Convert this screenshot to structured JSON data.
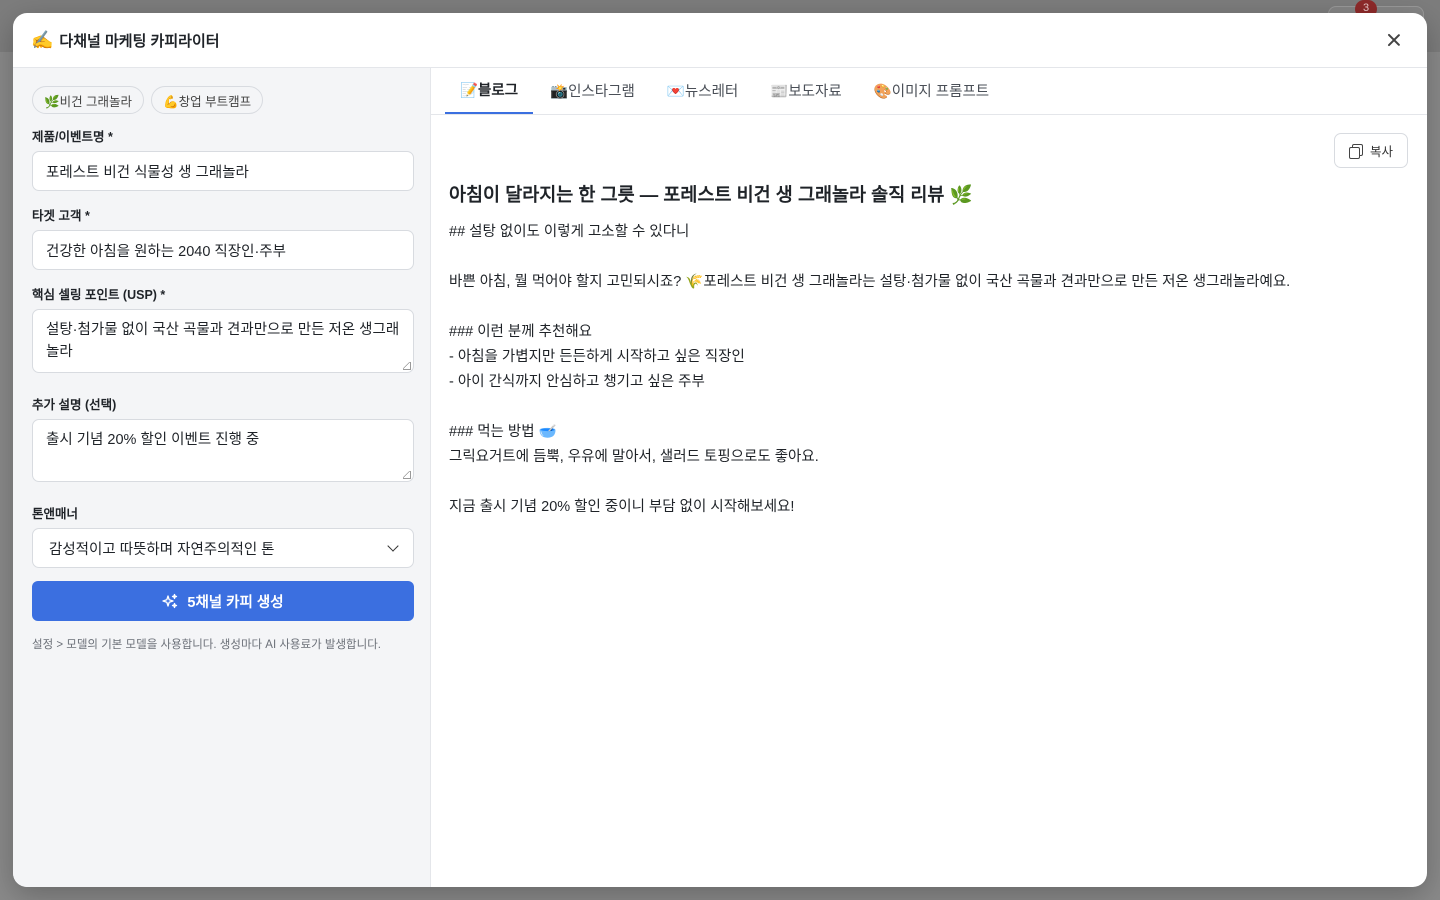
{
  "backdrop": {
    "badge_count": "3"
  },
  "modal": {
    "title_icon": "✍️",
    "title": "다채널 마케팅 카피라이터",
    "close_icon": "close-icon"
  },
  "presets": [
    {
      "label": "🌿비건 그래놀라"
    },
    {
      "label": "💪창업 부트캠프"
    }
  ],
  "form": {
    "product_label": "제품/이벤트명 *",
    "product_value": "포레스트 비건 식물성 생 그래놀라",
    "target_label": "타겟 고객 *",
    "target_value": "건강한 아침을 원하는 2040 직장인·주부",
    "usp_label": "핵심 셀링 포인트 (USP) *",
    "usp_value": "설탕·첨가물 없이 국산 곡물과 견과만으로 만든 저온 생그래놀라",
    "extra_label": "추가 설명 (선택)",
    "extra_value": "출시 기념 20% 할인 이벤트 진행 중",
    "tone_label": "톤앤매너",
    "tone_value": "감성적이고 따뜻하며 자연주의적인 톤",
    "generate_label": "5채널 카피 생성",
    "hint": "설정 > 모델의 기본 모델을 사용합니다. 생성마다 AI 사용료가 발생합니다."
  },
  "tabs": [
    {
      "label": "📝블로그",
      "active": true
    },
    {
      "label": "📸인스타그램",
      "active": false
    },
    {
      "label": "💌뉴스레터",
      "active": false
    },
    {
      "label": "📰보도자료",
      "active": false
    },
    {
      "label": "🎨이미지 프롬프트",
      "active": false
    }
  ],
  "output": {
    "copy_label": "복사",
    "title": "아침이 달라지는 한 그릇 — 포레스트 비건 생 그래놀라 솔직 리뷰 🌿",
    "lines": [
      "## 설탕 없이도 이렇게 고소할 수 있다니",
      "",
      "바쁜 아침, 뭘 먹어야 할지 고민되시죠? 🌾포레스트 비건 생 그래놀라는 설탕·첨가물 없이 국산 곡물과 견과만으로 만든 저온 생그래놀라예요.",
      "",
      "### 이런 분께 추천해요",
      "- 아침을 가볍지만 든든하게 시작하고 싶은 직장인",
      "- 아이 간식까지 안심하고 챙기고 싶은 주부",
      "",
      "### 먹는 방법 🥣",
      "그릭요거트에 듬뿍, 우유에 말아서, 샐러드 토핑으로도 좋아요.",
      "",
      "지금 출시 기념 20% 할인 중이니 부담 없이 시작해보세요!"
    ]
  }
}
